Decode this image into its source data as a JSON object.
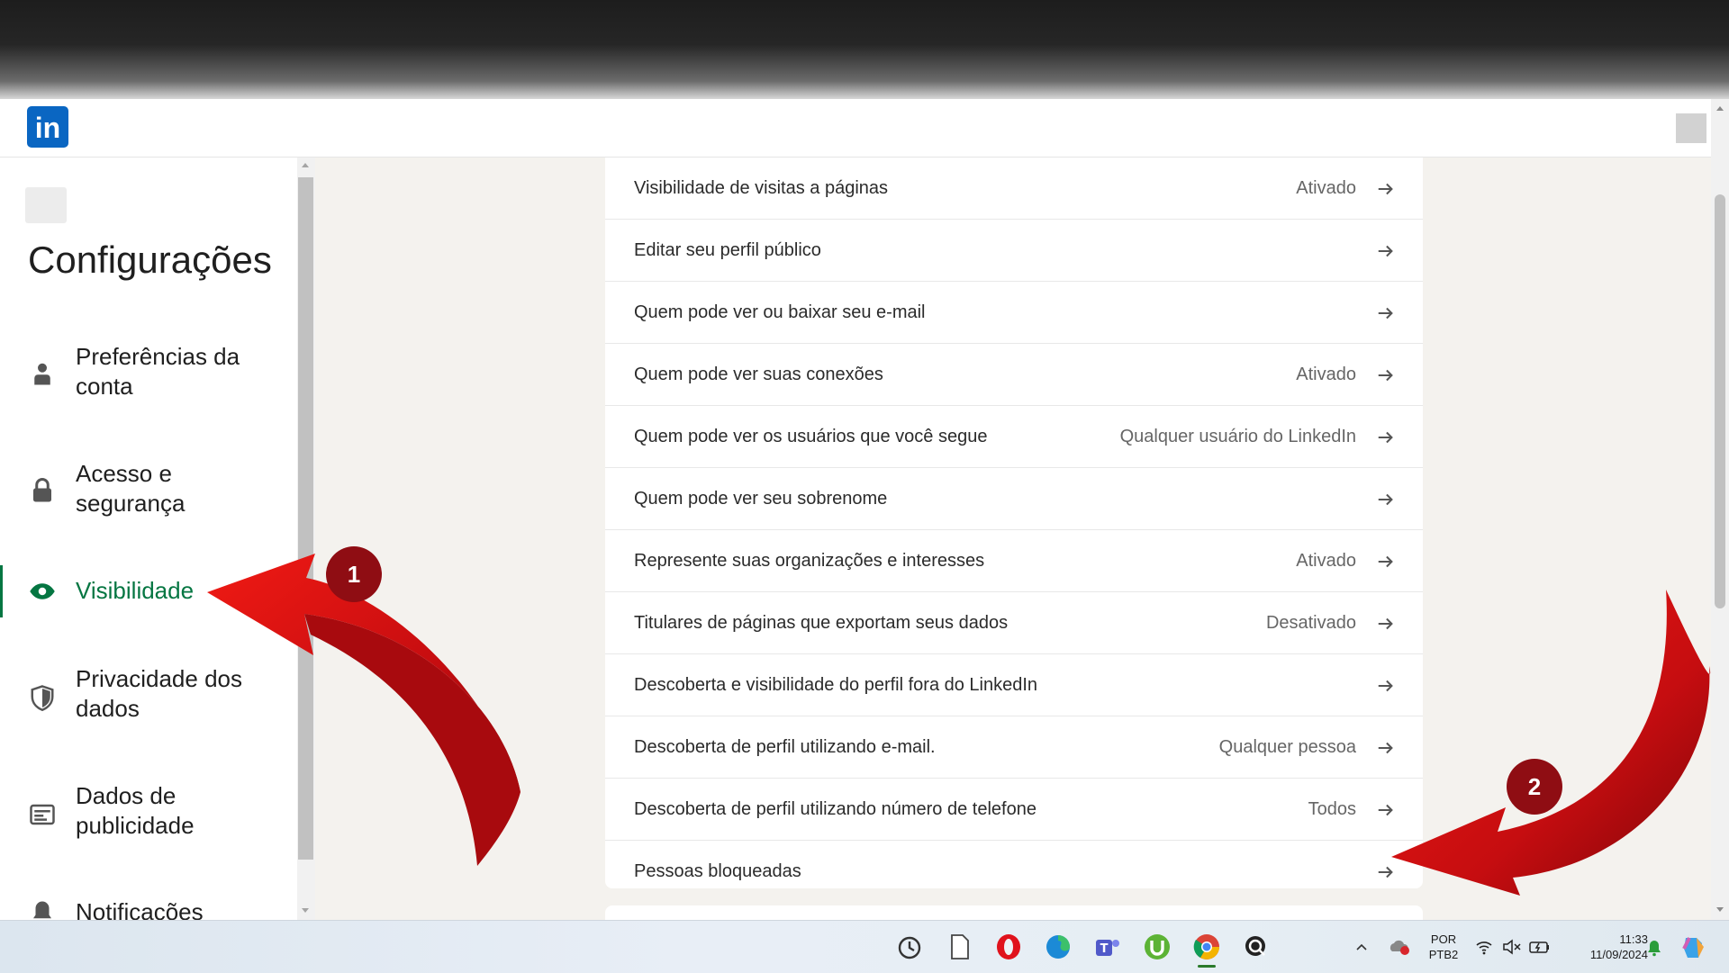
{
  "header": {
    "logo_text": "in",
    "brand_color": "#0a66c2"
  },
  "sidebar": {
    "title": "Configurações",
    "active_color": "#057642",
    "items": [
      {
        "label": "Preferências da conta",
        "icon": "person-icon"
      },
      {
        "label": "Acesso e segurança",
        "icon": "lock-icon"
      },
      {
        "label": "Visibilidade",
        "icon": "eye-icon",
        "active": true
      },
      {
        "label": "Privacidade dos dados",
        "icon": "shield-icon"
      },
      {
        "label": "Dados de publicidade",
        "icon": "ad-card-icon"
      },
      {
        "label": "Notificações",
        "icon": "bell-icon"
      }
    ]
  },
  "settings": {
    "rows": [
      {
        "label": "Visibilidade de visitas a páginas",
        "value": "Ativado"
      },
      {
        "label": "Editar seu perfil público",
        "value": ""
      },
      {
        "label": "Quem pode ver ou baixar seu e-mail",
        "value": ""
      },
      {
        "label": "Quem pode ver suas conexões",
        "value": "Ativado"
      },
      {
        "label": "Quem pode ver os usuários que você segue",
        "value": "Qualquer usuário do LinkedIn"
      },
      {
        "label": "Quem pode ver seu sobrenome",
        "value": ""
      },
      {
        "label": "Represente suas organizações e interesses",
        "value": "Ativado"
      },
      {
        "label": "Titulares de páginas que exportam seus dados",
        "value": "Desativado"
      },
      {
        "label": "Descoberta e visibilidade do perfil fora do LinkedIn",
        "value": ""
      },
      {
        "label": "Descoberta de perfil utilizando e-mail.",
        "value": "Qualquer pessoa"
      },
      {
        "label": "Descoberta de perfil utilizando número de telefone",
        "value": "Todos"
      },
      {
        "label": "Pessoas bloqueadas",
        "value": ""
      }
    ]
  },
  "annotations": {
    "badge_1": "1",
    "badge_2": "2",
    "arrow_color": "#d60d0d"
  },
  "taskbar": {
    "apps": [
      "clock-app-icon",
      "notepad-icon",
      "opera-icon",
      "edge-icon",
      "teams-icon",
      "utorrent-icon",
      "chrome-icon",
      "search-app-icon"
    ],
    "language_line1": "POR",
    "language_line2": "PTB2",
    "time": "11:33",
    "date": "11/09/2024"
  }
}
